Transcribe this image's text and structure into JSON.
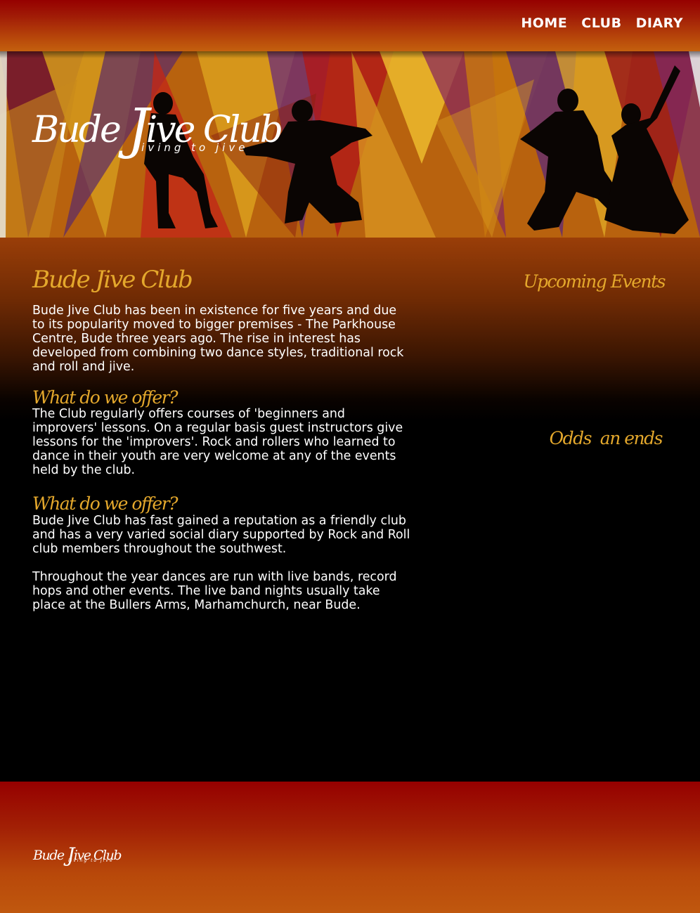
{
  "nav": {
    "items": [
      {
        "label": "HOME"
      },
      {
        "label": "CLUB"
      },
      {
        "label": "DIARY"
      }
    ]
  },
  "banner": {
    "logo_part1": "Bude ",
    "logo_j": "J",
    "logo_part2": "ive Club",
    "tagline": "living to jive"
  },
  "main": {
    "title": "Bude Jive Club",
    "intro": "Bude Jive Club has been in existence for five years and due to its popularity moved to bigger premises - The Parkhouse Centre, Bude three years ago. The rise in interest has developed from combining two dance styles, traditional rock and roll and jive.",
    "section1_heading": "What do we offer?",
    "section1_body": "The Club regularly offers courses of 'beginners and improvers' lessons. On a regular basis guest instructors give lessons for the 'improvers'. Rock and rollers who learned to dance in their youth are very welcome at any of the events held by the club.",
    "section2_heading": "What do we offer?",
    "section2_body1": "Bude Jive Club has fast gained a reputation as a friendly club and has a very varied social diary supported by Rock and Roll club members throughout the southwest.",
    "section2_body2": "Throughout the year dances are run with live bands, record hops and other events. The live band nights usually take place at the Bullers Arms, Marhamchurch, near Bude."
  },
  "sidebar": {
    "upcoming_title": "Upcoming Events",
    "odds_title": "Odds  an ends"
  },
  "footer": {
    "logo_part1": "Bude ",
    "logo_j": "J",
    "logo_part2": "ive Club",
    "tagline": "living to jive"
  },
  "colors": {
    "accent_gold": "#e4a82c",
    "header_red": "#960000",
    "header_orange": "#c4600e"
  }
}
